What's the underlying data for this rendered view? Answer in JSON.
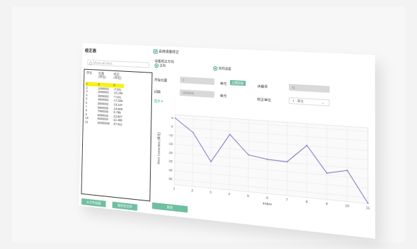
{
  "left_panel": {
    "title": "校正表",
    "show_all_label": "Show all lines",
    "columns": [
      "序号",
      "位置\n(单位)",
      "校正\n(单位)"
    ],
    "rows": [
      {
        "index": "1",
        "position": "0",
        "correction": "0",
        "selected": true
      },
      {
        "index": "2",
        "position": "1000000",
        "correction": "-7.501",
        "selected": false
      },
      {
        "index": "3",
        "position": "2000000",
        "correction": "-23.205",
        "selected": false
      },
      {
        "index": "4",
        "position": "3000000",
        "correction": "-7.041",
        "selected": false
      },
      {
        "index": "5",
        "position": "4000000",
        "correction": "-17.556",
        "selected": false
      },
      {
        "index": "6",
        "position": "5000000",
        "correction": "-19.247",
        "selected": false
      },
      {
        "index": "7",
        "position": "6000000",
        "correction": "-19.609",
        "selected": false
      },
      {
        "index": "8",
        "position": "7000000",
        "correction": "-9.785",
        "selected": false
      },
      {
        "index": "9",
        "position": "8000000",
        "correction": "-23.927",
        "selected": false
      },
      {
        "index": "10",
        "position": "9000000",
        "correction": "-21.499",
        "selected": false
      },
      {
        "index": "11",
        "position": "10000000",
        "correction": "-37.912",
        "selected": false
      }
    ],
    "buttons": {
      "load": "从文件加载",
      "save": "保存至文件"
    }
  },
  "right_panel": {
    "enable_label": "启用误差校正",
    "direction_label": "误差校正方向",
    "radio_positive": "正向",
    "radio_bidirectional": "双向误差",
    "start_label": "开始位置",
    "start_value": "0",
    "start_unit": "单元",
    "get_position_button": "位置获取",
    "points_label": "点编号",
    "points_value": "11",
    "interval_label": "间隔",
    "interval_value": "1000000",
    "interval_unit": "单元",
    "correction_unit_label": "校正单位",
    "correction_unit_value": "1 · 单元",
    "show_label": "显示 ▾",
    "apply_button": "更改"
  },
  "colors": {
    "accent": "#6fbfa0",
    "selected_row": "#f5f216",
    "line": "#8a84c8"
  },
  "chart_data": {
    "type": "line",
    "xlabel": "Index",
    "ylabel": "Error Correction (单元)",
    "x": [
      1,
      2,
      3,
      4,
      5,
      6,
      7,
      8,
      9,
      10,
      11
    ],
    "xticks": [
      "1",
      "2",
      "3",
      "4",
      "5",
      "6",
      "7",
      "8",
      "9",
      "10",
      "11"
    ],
    "yticks": [
      "0",
      "-5",
      "-10",
      "-15",
      "-20",
      "-25",
      "-30",
      "-35"
    ],
    "ylim": [
      -38,
      2
    ],
    "series": [
      {
        "values": [
          0,
          -7.5,
          -23.2,
          -7,
          -17.6,
          -19.2,
          -19.6,
          -9.8,
          -23.9,
          -21.5,
          -37.9
        ]
      }
    ],
    "grid": true
  }
}
